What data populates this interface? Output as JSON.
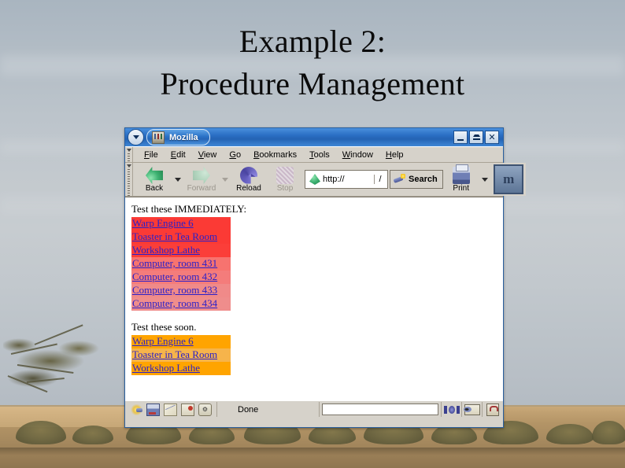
{
  "slide": {
    "title_line1": "Example 2:",
    "title_line2": "Procedure Management"
  },
  "browser": {
    "titlebar": {
      "window_menu_icon": "window-menu-caret",
      "app_icon": "mozilla-app-icon",
      "title": "Mozilla",
      "minimize_label": "Minimize",
      "maximize_label": "Maximize",
      "close_label": "Close"
    },
    "menubar": [
      {
        "label": "File",
        "accesskey": "F"
      },
      {
        "label": "Edit",
        "accesskey": "E"
      },
      {
        "label": "View",
        "accesskey": "V"
      },
      {
        "label": "Go",
        "accesskey": "G"
      },
      {
        "label": "Bookmarks",
        "accesskey": "B"
      },
      {
        "label": "Tools",
        "accesskey": "T"
      },
      {
        "label": "Window",
        "accesskey": "W"
      },
      {
        "label": "Help",
        "accesskey": "H"
      }
    ],
    "toolbar": {
      "back_label": "Back",
      "forward_label": "Forward",
      "reload_label": "Reload",
      "stop_label": "Stop",
      "print_label": "Print",
      "search_label": "Search",
      "url_value": "http://",
      "url_go_label": "/",
      "logo_label": "m"
    },
    "statusbar": {
      "status_text": "Done",
      "icons": [
        "navigator-icon",
        "composer-icon",
        "mail-icon",
        "address-book-icon",
        "preferences-icon"
      ],
      "right_icons": [
        "connection-icon",
        "cookie-icon",
        "security-icon"
      ]
    },
    "page": {
      "section1_heading": "Test these IMMEDIATELY:",
      "section1_color": "#FF3B30",
      "section1_links": [
        "Warp Engine 6",
        "Toaster in Tea Room",
        "Workshop Lathe",
        "Computer, room 431",
        "Computer, room 432",
        "Computer, room 433",
        "Computer, room 434"
      ],
      "section1_row_colors": [
        "#fb3a35",
        "#fb3a35",
        "#fb3e39",
        "#f7736f",
        "#f47c7b",
        "#f08a89",
        "#ef8d8c"
      ],
      "section2_heading": "Test these soon.",
      "section2_color": "#FFA500",
      "section2_links": [
        "Warp Engine 6",
        "Toaster in Tea Room",
        "Workshop Lathe"
      ],
      "section2_row_colors": [
        "#ffa400",
        "#f6b44b",
        "#ffa400"
      ],
      "link_text_color": "#2b20c8"
    }
  }
}
